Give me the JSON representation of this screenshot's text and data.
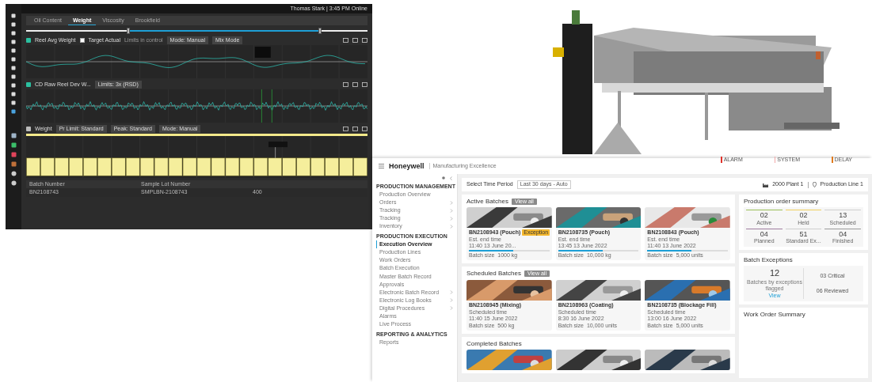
{
  "dashboard": {
    "user": "Thomas Stark | 3:45 PM Online",
    "tabs": [
      {
        "label": "Oil Content",
        "selected": false
      },
      {
        "label": "Weight",
        "selected": true
      },
      {
        "label": "Viscosity",
        "selected": false
      },
      {
        "label": "Brookfield",
        "selected": false
      }
    ],
    "range_slider": {
      "handles": [
        {
          "level": 0.3
        },
        {
          "level": 0.86
        }
      ]
    },
    "panels": [
      {
        "kind": "line",
        "title": "Reel Avg Weight",
        "checkbox_label": "Target Actual",
        "checkbox_checked": false,
        "note": "Limits in control",
        "controls": [
          "Mode: Manual",
          "Mix Mode"
        ]
      },
      {
        "kind": "noise",
        "title": "CD Raw Reel Dev W...",
        "controls": [
          "Limits: 3x (RSD)"
        ]
      },
      {
        "kind": "bar",
        "title": "Weight",
        "controls": [
          "Pr Limit: Standard",
          "Peak: Standard",
          "Mode: Manual"
        ]
      }
    ],
    "table": {
      "columns": [
        "Batch Number",
        "Sample Lot Number"
      ],
      "rows": [
        [
          "BN2108743",
          "SMPLBN-2108743",
          "400"
        ]
      ]
    }
  },
  "app": {
    "brand": "Honeywell",
    "title": "Manufacturing Excellence",
    "alerts": [
      {
        "label": "ALARM",
        "color": "#e0332b"
      },
      {
        "label": "SYSTEM",
        "color": "#f2a7a7"
      },
      {
        "label": "DELAY",
        "color": "#e07b1f"
      }
    ],
    "sidebar": [
      {
        "title": "PRODUCTION MANAGEMENT",
        "items": [
          {
            "label": "Production Overview",
            "selected": false,
            "expandable": false
          },
          {
            "label": "Orders",
            "selected": false,
            "expandable": true
          },
          {
            "label": "Tracking",
            "selected": false,
            "expandable": true
          },
          {
            "label": "Tracking",
            "selected": false,
            "expandable": true
          },
          {
            "label": "Inventory",
            "selected": false,
            "expandable": true
          }
        ]
      },
      {
        "title": "PRODUCTION EXECUTION",
        "items": [
          {
            "label": "Execution Overview",
            "selected": true,
            "expandable": false
          },
          {
            "label": "Production Lines",
            "selected": false,
            "expandable": false
          },
          {
            "label": "Work Orders",
            "selected": false,
            "expandable": false
          },
          {
            "label": "Batch Execution",
            "selected": false,
            "expandable": false
          },
          {
            "label": "Master Batch Record",
            "selected": false,
            "expandable": false
          },
          {
            "label": "Approvals",
            "selected": false,
            "expandable": false
          },
          {
            "label": "Electronic Batch Record",
            "selected": false,
            "expandable": true
          },
          {
            "label": "Electronic Log Books",
            "selected": false,
            "expandable": true
          },
          {
            "label": "Digital Procedures",
            "selected": false,
            "expandable": true
          },
          {
            "label": "Alarms",
            "selected": false,
            "expandable": false
          },
          {
            "label": "Live Process",
            "selected": false,
            "expandable": false
          }
        ]
      },
      {
        "title": "REPORTING & ANALYTICS",
        "items": [
          {
            "label": "Reports",
            "selected": false,
            "expandable": false
          }
        ]
      }
    ],
    "filter": {
      "label": "Select Time Period",
      "value": "Last 30 days - Auto"
    },
    "plant": "2000 Plant 1",
    "line": "Production Line 1",
    "batch_groups": [
      {
        "title": "Active Batches",
        "badge": "View all",
        "cards": [
          {
            "title": "BN2108943 (Pouch)",
            "tag": "Exception",
            "rows": [
              {
                "label": "Est. end time",
                "value": "11:40 13 June 20..."
              },
              {
                "label": "Batch size",
                "value": "1000 kg"
              }
            ],
            "level": 0.55
          },
          {
            "title": "BN2108735 (Pouch)",
            "rows": [
              {
                "label": "Est. end time",
                "value": "13:45 13 June 2022"
              },
              {
                "label": "Batch size",
                "value": "10,000 kg"
              }
            ],
            "level": 0.55
          },
          {
            "title": "BN2108843 (Pouch)",
            "rows": [
              {
                "label": "Est. end time",
                "value": "11:40 13 June 2022"
              },
              {
                "label": "Batch size",
                "value": "5,000 units"
              }
            ],
            "level": 0.55
          }
        ]
      },
      {
        "title": "Scheduled Batches",
        "badge": "View all",
        "cards": [
          {
            "title": "BN2108945 (Mixing)",
            "rows": [
              {
                "label": "Scheduled time",
                "value": "11:40 15 June 2022"
              },
              {
                "label": "Batch size",
                "value": "500 kg"
              }
            ]
          },
          {
            "title": "BN2108963 (Coating)",
            "rows": [
              {
                "label": "Scheduled time",
                "value": "8:30 16 June 2022"
              },
              {
                "label": "Batch size",
                "value": "10,000 units"
              }
            ]
          },
          {
            "title": "BN2108735 (Blockage Fill)",
            "rows": [
              {
                "label": "Scheduled time",
                "value": "13:00 16 June 2022"
              },
              {
                "label": "Batch size",
                "value": "5,000 units"
              }
            ]
          }
        ]
      },
      {
        "title": "Completed Batches"
      }
    ],
    "order_summary": {
      "title": "Production order summary",
      "tiles": [
        {
          "value": "02",
          "label": "Active",
          "color": "#9cbf5a"
        },
        {
          "value": "02",
          "label": "Held",
          "color": "#f0d060"
        },
        {
          "value": "13",
          "label": "Scheduled",
          "color": "#cfcfcf"
        },
        {
          "value": "04",
          "label": "Planned",
          "color": "#a07ea0"
        },
        {
          "value": "51",
          "label": "Standard Ex...",
          "color": "#cfcfcf"
        },
        {
          "value": "04",
          "label": "Finished",
          "color": "#9a9a9a"
        }
      ]
    },
    "exceptions": {
      "title": "Batch Exceptions",
      "count": "12",
      "caption": "Batches by exceptions flagged",
      "link": "View",
      "lines": [
        "03 Critical",
        "06 Reviewed"
      ]
    },
    "work_orders": {
      "title": "Work Order Summary"
    }
  }
}
